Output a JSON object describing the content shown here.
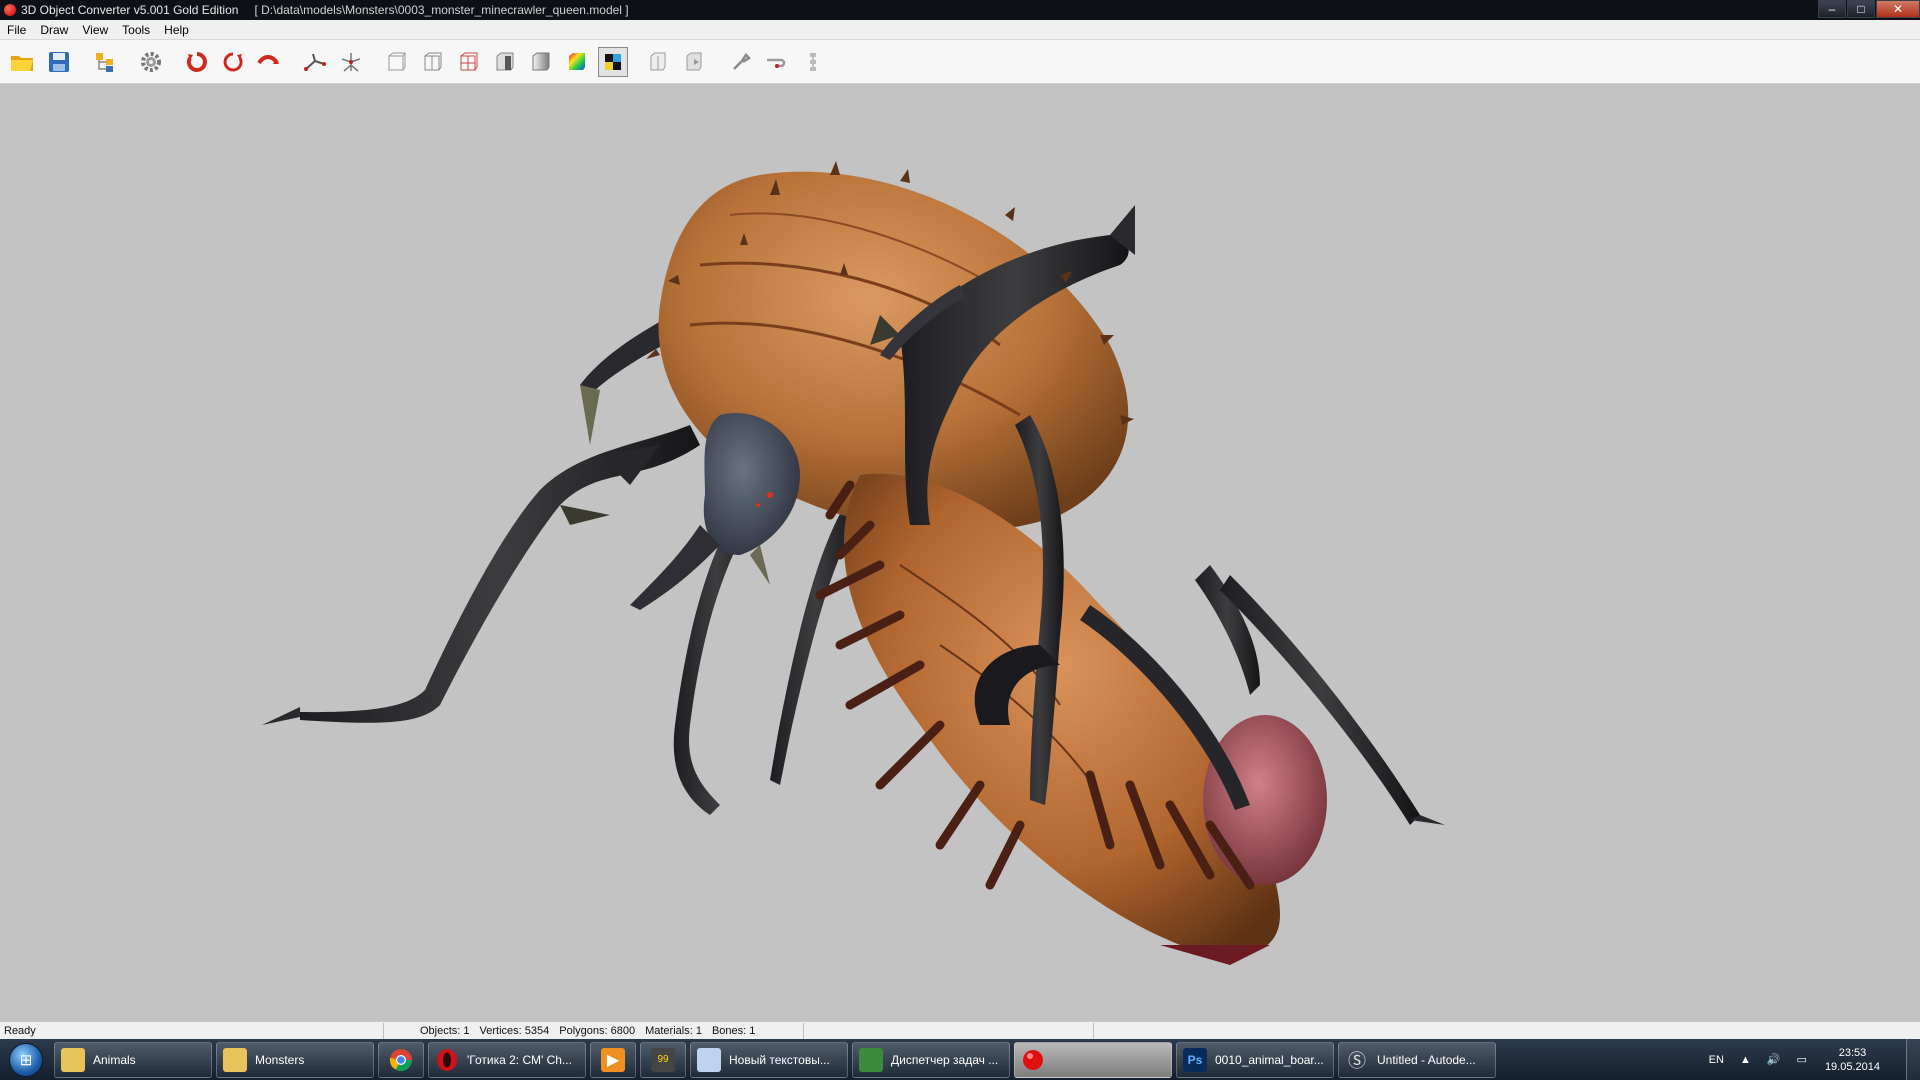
{
  "window": {
    "title": "3D Object Converter v5.001 Gold Edition",
    "path": "[ D:\\data\\models\\Monsters\\0003_monster_minecrawler_queen.model ]",
    "controls": {
      "minimize": "–",
      "maximize": "□",
      "close": "✕"
    }
  },
  "menu": {
    "file": "File",
    "draw": "Draw",
    "view": "View",
    "tools": "Tools",
    "help": "Help"
  },
  "toolbar": {
    "icons": [
      "open-folder-icon",
      "save-icon",
      "object-tree-icon",
      "settings-gear-icon",
      "rotate-x-icon",
      "rotate-y-icon",
      "rotate-z-icon",
      "bone-icon",
      "skeleton-icon",
      "wireframe-front-icon",
      "wireframe-side-icon",
      "wireframe-red-icon",
      "solid-icon",
      "smooth-shaded-icon",
      "color-icon",
      "texture-checker-icon",
      "flip-icon",
      "mirror-icon",
      "tool-icon",
      "link-icon",
      "hierarchy-icon"
    ],
    "pressed": "texture-checker-icon"
  },
  "status": {
    "state": "Ready",
    "objects": "Objects: 1",
    "vertices": "Vertices: 5354",
    "polygons": "Polygons: 6800",
    "materials": "Materials: 1",
    "bones": "Bones: 1"
  },
  "taskbar": {
    "tasks": [
      {
        "label": "Animals",
        "icon": "folder-icon"
      },
      {
        "label": "Monsters",
        "icon": "folder-icon"
      },
      {
        "label": "",
        "icon": "chrome-icon"
      },
      {
        "label": "'Готика 2: СМ' Ch...",
        "icon": "opera-icon"
      },
      {
        "label": "",
        "icon": "media-player-icon"
      },
      {
        "label": "",
        "icon": "winamp-icon"
      },
      {
        "label": "Новый текстовы...",
        "icon": "notepad-icon"
      },
      {
        "label": "Диспетчер задач ...",
        "icon": "task-manager-icon"
      },
      {
        "label": "",
        "icon": "converter-icon"
      },
      {
        "label": "0010_animal_boar...",
        "icon": "photoshop-icon"
      },
      {
        "label": "Untitled - Autode...",
        "icon": "3dsmax-icon"
      }
    ],
    "tray": {
      "language": "EN",
      "time": "23:53",
      "date": "19.05.2014"
    }
  }
}
